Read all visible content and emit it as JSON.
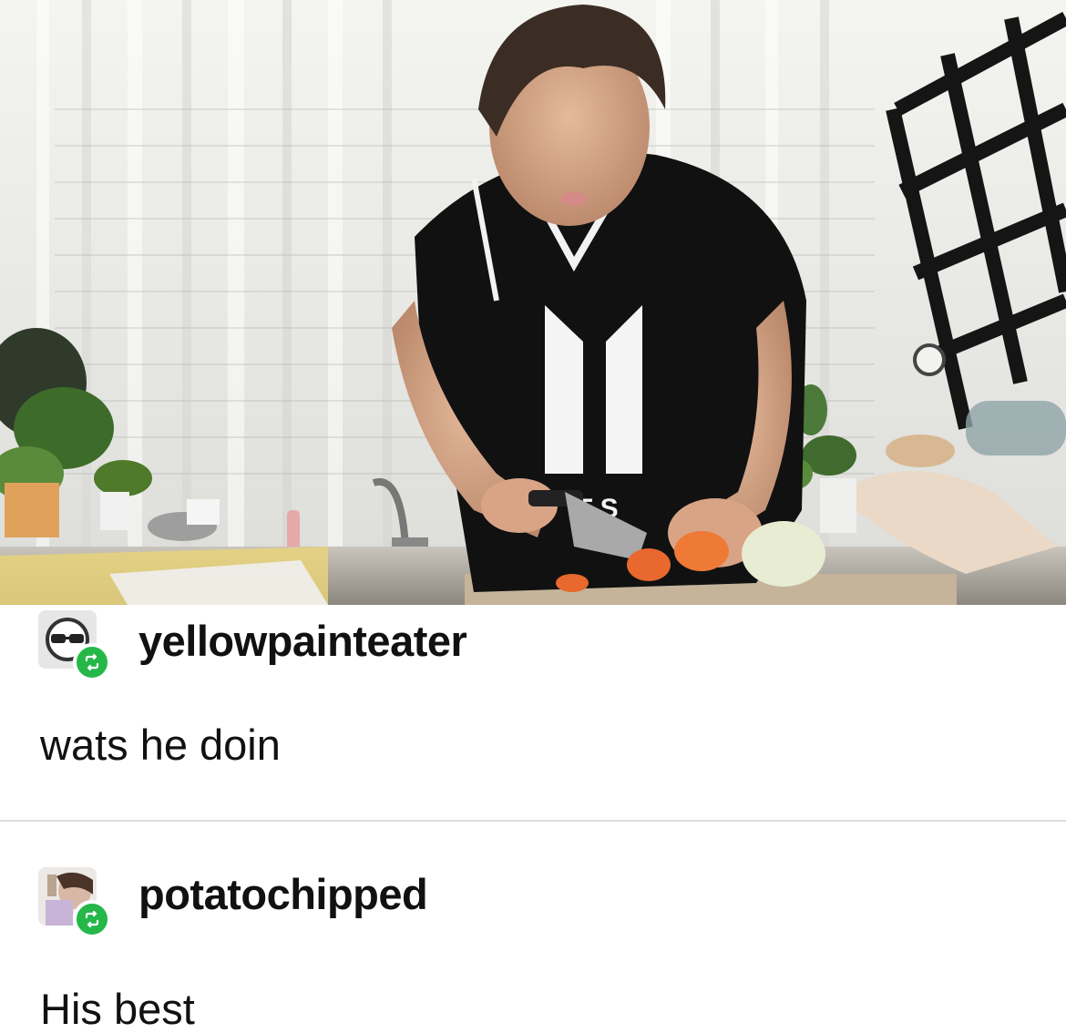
{
  "posts": [
    {
      "username": "yellowpainteater",
      "text": "wats he doin",
      "avatar_icon": "sunglasses-avatar",
      "badge_icon": "reblog-icon",
      "badge_color": "#25b849"
    },
    {
      "username": "potatochipped",
      "text": "His best",
      "avatar_icon": "photo-avatar",
      "badge_icon": "reblog-icon",
      "badge_color": "#25b849"
    }
  ],
  "photo": {
    "subject": "person-cutting-carrot-in-kitchen",
    "shirt_text": "T S"
  }
}
